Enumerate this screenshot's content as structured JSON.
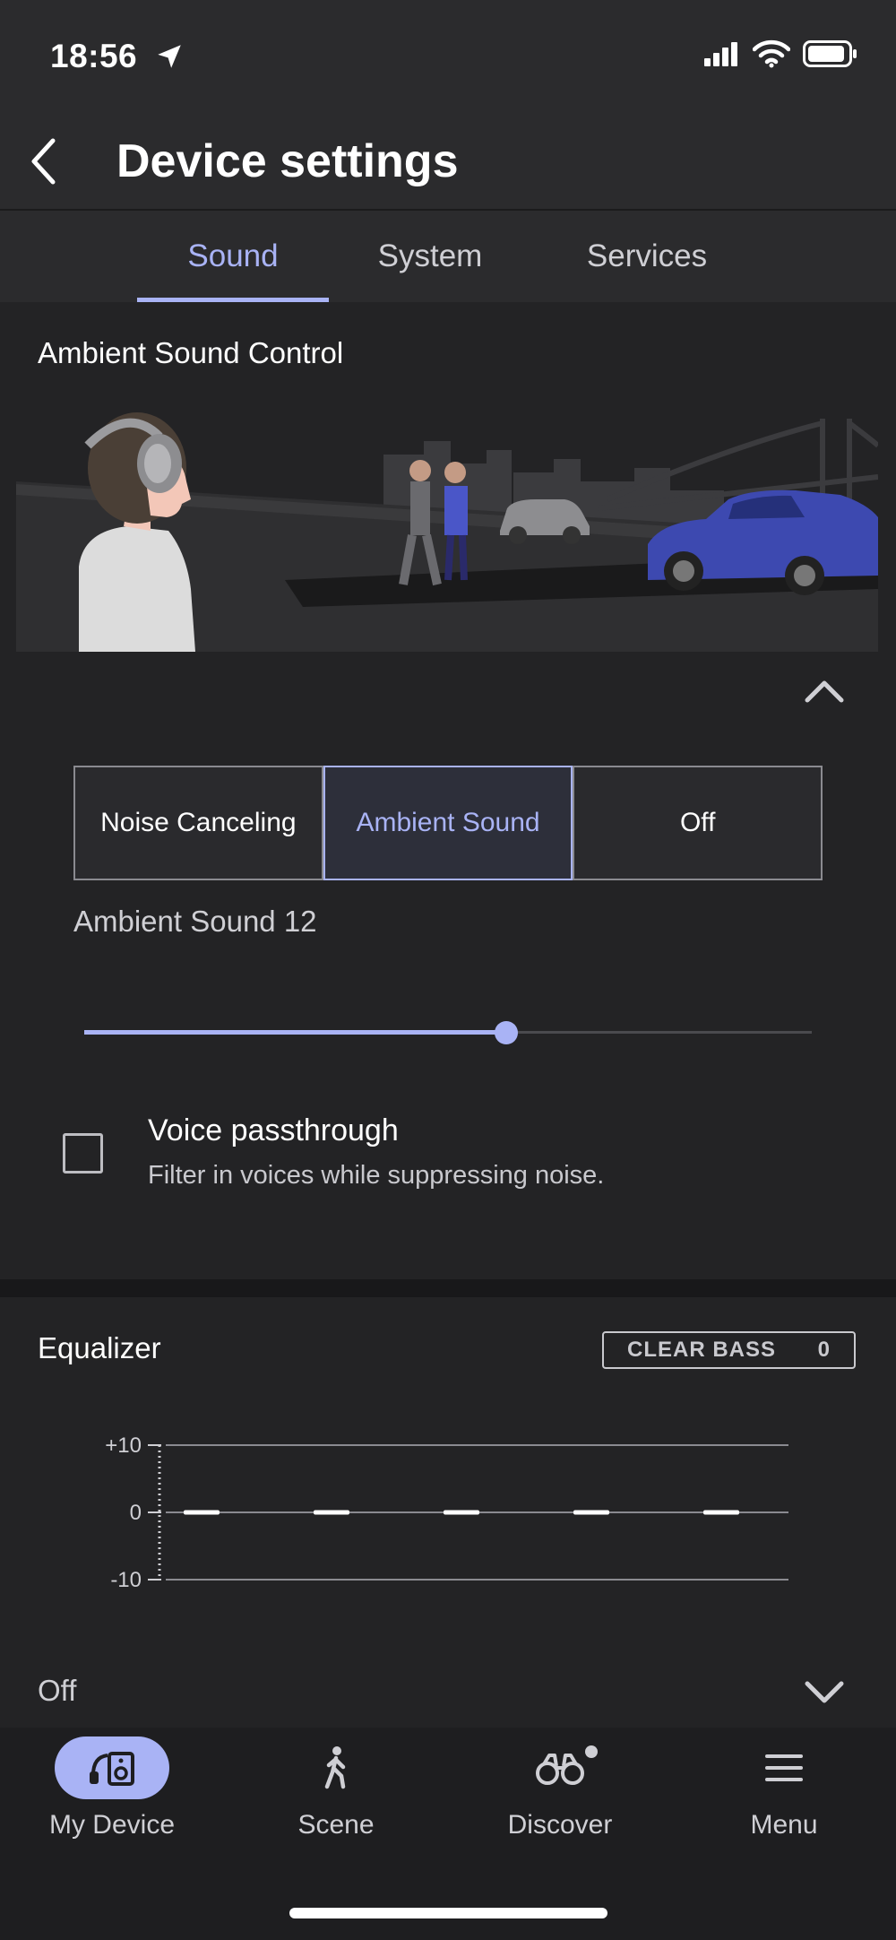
{
  "status": {
    "time": "18:56"
  },
  "header": {
    "title": "Device settings"
  },
  "tabs": [
    {
      "label": "Sound",
      "active": true
    },
    {
      "label": "System",
      "active": false
    },
    {
      "label": "Services",
      "active": false
    }
  ],
  "ambient_control": {
    "title": "Ambient Sound Control",
    "modes": [
      {
        "label": "Noise Canceling",
        "active": false
      },
      {
        "label": "Ambient Sound",
        "active": true
      },
      {
        "label": "Off",
        "active": false
      }
    ],
    "level_label": "Ambient Sound 12",
    "slider_level_fraction": 0.58,
    "voice_passthrough": {
      "title": "Voice passthrough",
      "description": "Filter in voices while suppressing noise.",
      "checked": false
    }
  },
  "equalizer": {
    "title": "Equalizer",
    "clear_bass_label": "CLEAR BASS",
    "clear_bass_value": "0",
    "y_ticks": [
      "+10",
      "0",
      "-10"
    ],
    "band_levels": [
      0,
      0,
      0,
      0,
      0
    ],
    "state": "Off"
  },
  "bottom_nav": [
    {
      "label": "My Device",
      "icon": "headphones-speaker-icon",
      "active": true
    },
    {
      "label": "Scene",
      "icon": "walking-person-icon",
      "active": false
    },
    {
      "label": "Discover",
      "icon": "binoculars-icon",
      "active": false
    },
    {
      "label": "Menu",
      "icon": "hamburger-menu-icon",
      "active": false
    }
  ],
  "colors": {
    "accent": "#a9b3f5",
    "background": "#232325",
    "header_bg": "#2b2b2d"
  }
}
